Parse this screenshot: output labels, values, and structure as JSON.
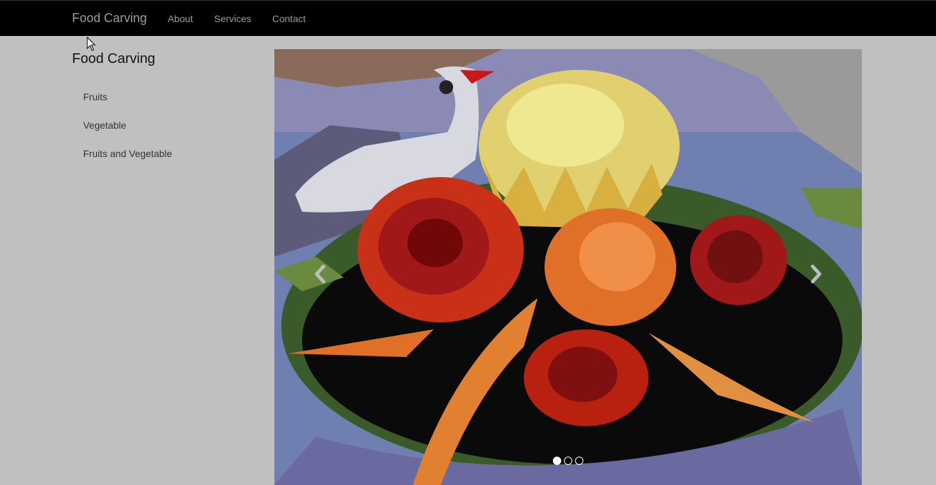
{
  "navbar": {
    "brand": "Food Carving",
    "links": [
      {
        "label": "About"
      },
      {
        "label": "Services"
      },
      {
        "label": "Contact"
      }
    ]
  },
  "sidebar": {
    "title": "Food Carving",
    "items": [
      {
        "label": "Fruits"
      },
      {
        "label": "Vegetable"
      },
      {
        "label": "Fruits and Vegetable"
      }
    ]
  },
  "carousel": {
    "prev_icon": "chevron-left-icon",
    "next_icon": "chevron-right-icon",
    "slide_count": 3,
    "active_slide": 1
  },
  "colors": {
    "navbar_bg": "#000000",
    "page_bg": "#c0c0c0",
    "nav_text": "#9d9d9d"
  }
}
